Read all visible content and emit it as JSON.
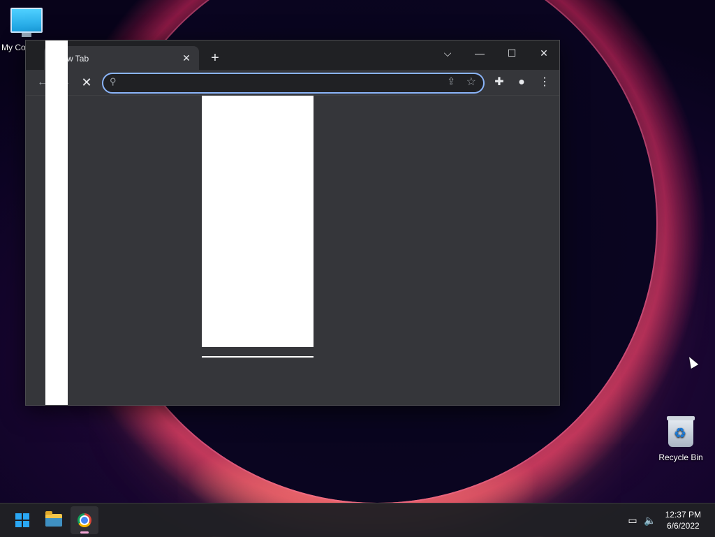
{
  "desktop": {
    "icons": [
      {
        "label": "My Co"
      },
      {
        "label": "Recycle Bin"
      }
    ]
  },
  "browser": {
    "tab": {
      "title": "w Tab",
      "close": "✕"
    },
    "new_tab": "+",
    "window_controls": {
      "tab_search": "⌵",
      "minimize": "—",
      "maximize": "☐",
      "close": "✕"
    },
    "toolbar": {
      "back": "←",
      "forward": "→",
      "stop": "✕",
      "omnibox": {
        "value": "",
        "placeholder": ""
      },
      "share": "⇪",
      "bookmark": "☆",
      "extensions": "✚",
      "profile": "●",
      "menu": "⋮"
    }
  },
  "taskbar": {
    "apps": [
      "start",
      "file-explorer",
      "chrome"
    ],
    "clock": {
      "time": "12:37 PM",
      "date": "6/6/2022"
    }
  }
}
